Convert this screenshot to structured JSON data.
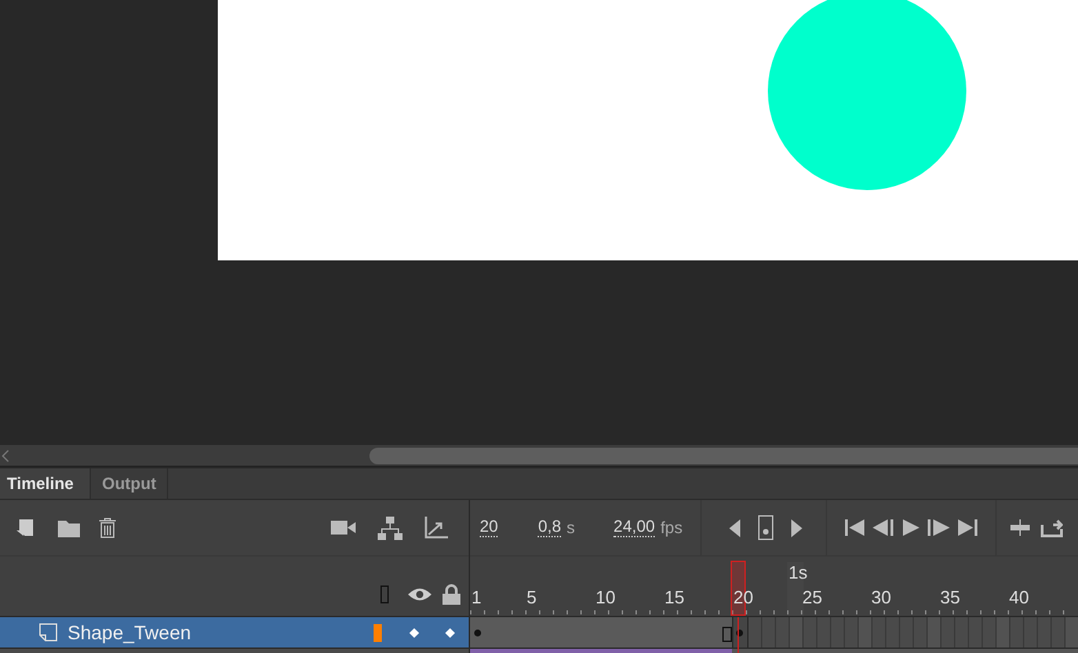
{
  "tabs": [
    {
      "label": "Timeline",
      "selected": true
    },
    {
      "label": "Output",
      "selected": false
    }
  ],
  "playback": {
    "frame": "20",
    "time": "0,8",
    "time_unit": "s",
    "fps": "24,00",
    "fps_unit": "fps"
  },
  "ruler": {
    "second_marker": "1s",
    "labels": [
      "1",
      "5",
      "10",
      "15",
      "20",
      "25",
      "30",
      "35",
      "40"
    ]
  },
  "layers": [
    {
      "name": "Shape_Tween",
      "selected": true,
      "color": "#ff7f00"
    }
  ]
}
